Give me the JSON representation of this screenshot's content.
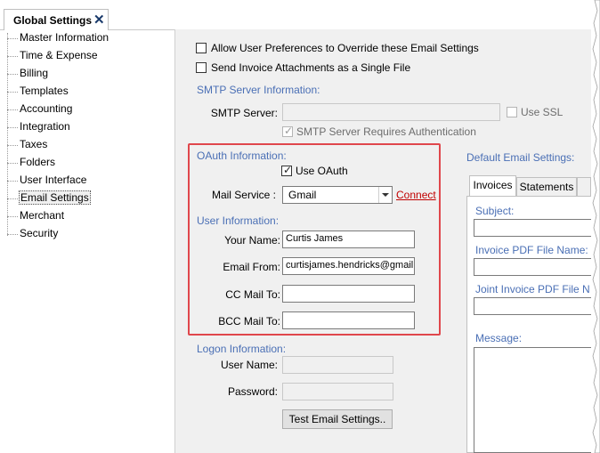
{
  "doc_tab": {
    "title": "Global Settings",
    "close": "✕"
  },
  "tree": {
    "items": [
      "Master Information",
      "Time & Expense",
      "Billing",
      "Templates",
      "Accounting",
      "Integration",
      "Taxes",
      "Folders",
      "User Interface",
      "Email Settings",
      "Merchant",
      "Security"
    ],
    "selected": "Email Settings"
  },
  "options": {
    "allow_user_prefs": {
      "label": "Allow User Preferences to Override these Email Settings",
      "checked": false
    },
    "single_file": {
      "label": "Send Invoice Attachments as a Single File",
      "checked": false
    }
  },
  "smtp": {
    "section": "SMTP Server Information:",
    "server_label": "SMTP Server:",
    "server_value": "",
    "use_ssl": "Use SSL",
    "requires_auth": "SMTP Server Requires Authentication"
  },
  "oauth": {
    "section": "OAuth Information:",
    "use_oauth": "Use OAuth",
    "mail_service_label": "Mail Service :",
    "mail_service_value": "Gmail",
    "connect": "Connect"
  },
  "user_info": {
    "section": "User Information:",
    "your_name_label": "Your Name:",
    "your_name_value": "Curtis James",
    "email_from_label": "Email From:",
    "email_from_value": "curtisjames.hendricks@gmail.c",
    "cc_label": "CC Mail To:",
    "cc_value": "",
    "bcc_label": "BCC Mail To:",
    "bcc_value": ""
  },
  "logon": {
    "section": "Logon Information:",
    "user_name_label": "User Name:",
    "password_label": "Password:",
    "test_button": "Test Email Settings.."
  },
  "defaults": {
    "section": "Default Email Settings:",
    "tabs": [
      "Invoices",
      "Statements"
    ],
    "subject_label": "Subject:",
    "invoice_pdf_label": "Invoice PDF File Name:",
    "joint_pdf_label": "Joint Invoice PDF File N",
    "message_label": "Message:"
  },
  "colors": {
    "section_blue": "#4a6fb5",
    "highlight_red": "#e0474c",
    "link_red": "#c00000"
  }
}
